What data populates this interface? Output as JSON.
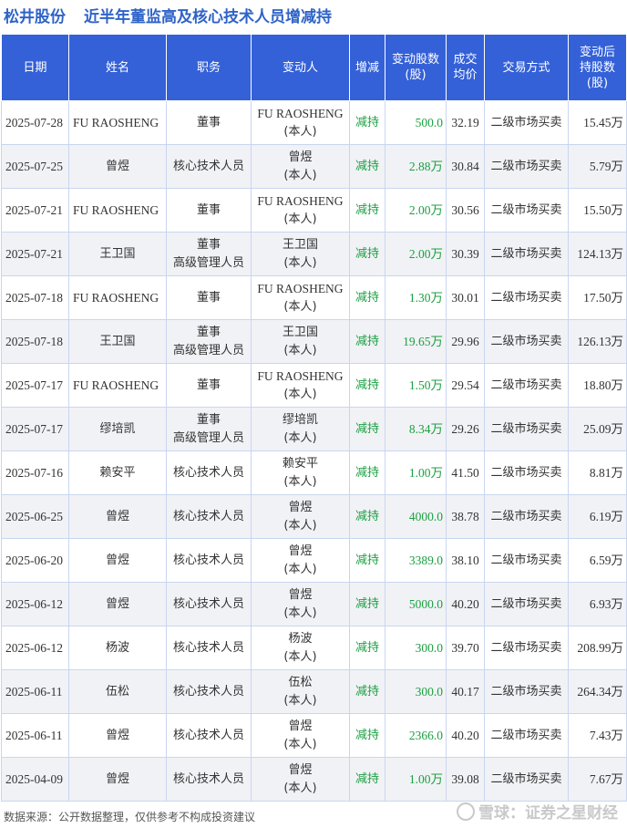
{
  "header": {
    "company": "松井股份",
    "title": "近半年董监高及核心技术人员增减持"
  },
  "columns": [
    "日期",
    "姓名",
    "职务",
    "变动人",
    "增减",
    "变动股数\n(股)",
    "成交\n均价",
    "交易方式",
    "变动后\n持股数\n(股)"
  ],
  "rows": [
    {
      "date": "2025-07-28",
      "name": "FU RAOSHENG",
      "position": [
        "董事"
      ],
      "changer": [
        "FU RAOSHENG",
        "(本人)"
      ],
      "direction": "减持",
      "shares": "500.0",
      "price": "32.19",
      "method": "二级市场买卖",
      "after": "15.45万"
    },
    {
      "date": "2025-07-25",
      "name": "曾煜",
      "position": [
        "核心技术人员"
      ],
      "changer": [
        "曾煜",
        "(本人)"
      ],
      "direction": "减持",
      "shares": "2.88万",
      "price": "30.84",
      "method": "二级市场买卖",
      "after": "5.79万"
    },
    {
      "date": "2025-07-21",
      "name": "FU RAOSHENG",
      "position": [
        "董事"
      ],
      "changer": [
        "FU RAOSHENG",
        "(本人)"
      ],
      "direction": "减持",
      "shares": "2.00万",
      "price": "30.56",
      "method": "二级市场买卖",
      "after": "15.50万"
    },
    {
      "date": "2025-07-21",
      "name": "王卫国",
      "position": [
        "董事",
        "高级管理人员"
      ],
      "changer": [
        "王卫国",
        "(本人)"
      ],
      "direction": "减持",
      "shares": "2.00万",
      "price": "30.39",
      "method": "二级市场买卖",
      "after": "124.13万"
    },
    {
      "date": "2025-07-18",
      "name": "FU RAOSHENG",
      "position": [
        "董事"
      ],
      "changer": [
        "FU RAOSHENG",
        "(本人)"
      ],
      "direction": "减持",
      "shares": "1.30万",
      "price": "30.01",
      "method": "二级市场买卖",
      "after": "17.50万"
    },
    {
      "date": "2025-07-18",
      "name": "王卫国",
      "position": [
        "董事",
        "高级管理人员"
      ],
      "changer": [
        "王卫国",
        "(本人)"
      ],
      "direction": "减持",
      "shares": "19.65万",
      "price": "29.96",
      "method": "二级市场买卖",
      "after": "126.13万"
    },
    {
      "date": "2025-07-17",
      "name": "FU RAOSHENG",
      "position": [
        "董事"
      ],
      "changer": [
        "FU RAOSHENG",
        "(本人)"
      ],
      "direction": "减持",
      "shares": "1.50万",
      "price": "29.54",
      "method": "二级市场买卖",
      "after": "18.80万"
    },
    {
      "date": "2025-07-17",
      "name": "缪培凯",
      "position": [
        "董事",
        "高级管理人员"
      ],
      "changer": [
        "缪培凯",
        "(本人)"
      ],
      "direction": "减持",
      "shares": "8.34万",
      "price": "29.26",
      "method": "二级市场买卖",
      "after": "25.09万"
    },
    {
      "date": "2025-07-16",
      "name": "赖安平",
      "position": [
        "核心技术人员"
      ],
      "changer": [
        "赖安平",
        "(本人)"
      ],
      "direction": "减持",
      "shares": "1.00万",
      "price": "41.50",
      "method": "二级市场买卖",
      "after": "8.81万"
    },
    {
      "date": "2025-06-25",
      "name": "曾煜",
      "position": [
        "核心技术人员"
      ],
      "changer": [
        "曾煜",
        "(本人)"
      ],
      "direction": "减持",
      "shares": "4000.0",
      "price": "38.78",
      "method": "二级市场买卖",
      "after": "6.19万"
    },
    {
      "date": "2025-06-20",
      "name": "曾煜",
      "position": [
        "核心技术人员"
      ],
      "changer": [
        "曾煜",
        "(本人)"
      ],
      "direction": "减持",
      "shares": "3389.0",
      "price": "38.10",
      "method": "二级市场买卖",
      "after": "6.59万"
    },
    {
      "date": "2025-06-12",
      "name": "曾煜",
      "position": [
        "核心技术人员"
      ],
      "changer": [
        "曾煜",
        "(本人)"
      ],
      "direction": "减持",
      "shares": "5000.0",
      "price": "40.20",
      "method": "二级市场买卖",
      "after": "6.93万"
    },
    {
      "date": "2025-06-12",
      "name": "杨波",
      "position": [
        "核心技术人员"
      ],
      "changer": [
        "杨波",
        "(本人)"
      ],
      "direction": "减持",
      "shares": "300.0",
      "price": "39.70",
      "method": "二级市场买卖",
      "after": "208.99万"
    },
    {
      "date": "2025-06-11",
      "name": "伍松",
      "position": [
        "核心技术人员"
      ],
      "changer": [
        "伍松",
        "(本人)"
      ],
      "direction": "减持",
      "shares": "300.0",
      "price": "40.17",
      "method": "二级市场买卖",
      "after": "264.34万"
    },
    {
      "date": "2025-06-11",
      "name": "曾煜",
      "position": [
        "核心技术人员"
      ],
      "changer": [
        "曾煜",
        "(本人)"
      ],
      "direction": "减持",
      "shares": "2366.0",
      "price": "40.20",
      "method": "二级市场买卖",
      "after": "7.43万"
    },
    {
      "date": "2025-04-09",
      "name": "曾煜",
      "position": [
        "核心技术人员"
      ],
      "changer": [
        "曾煜",
        "(本人)"
      ],
      "direction": "减持",
      "shares": "1.00万",
      "price": "39.08",
      "method": "二级市场买卖",
      "after": "7.67万"
    }
  ],
  "footer": {
    "source": "数据来源：公开数据整理，仅供参考不构成投资建议",
    "brand": "雪球：证券之星财经"
  },
  "watermark": "证券之星",
  "colors": {
    "header_bg": "#3461d8",
    "title": "#2f63c8",
    "decrease": "#1aa040",
    "row_alt": "#f1f2f6"
  }
}
